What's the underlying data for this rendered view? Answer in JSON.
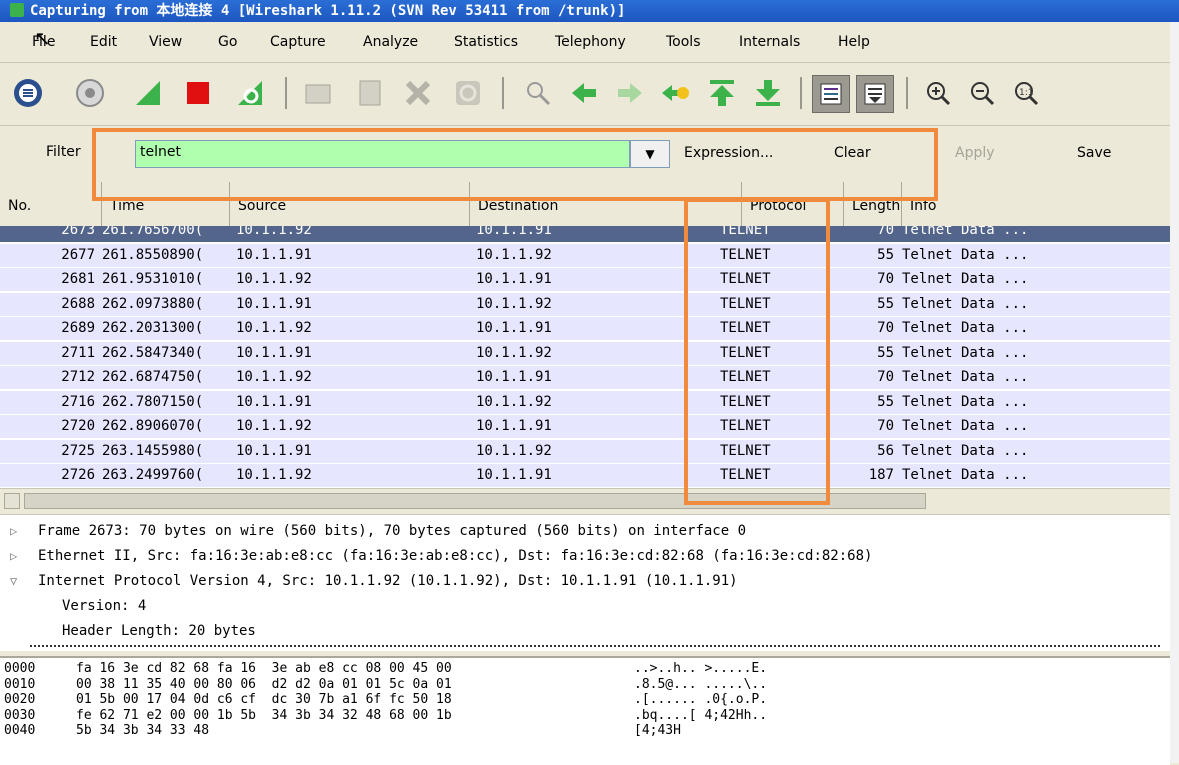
{
  "window": {
    "title": "Capturing from 本地连接 4    [Wireshark 1.11.2  (SVN Rev 53411 from /trunk)]"
  },
  "menu": [
    "File",
    "Edit",
    "View",
    "Go",
    "Capture",
    "Analyze",
    "Statistics",
    "Telephony",
    "Tools",
    "Internals",
    "Help"
  ],
  "toolbar_icons": [
    "interfaces-icon",
    "options-icon",
    "start-capture-icon",
    "stop-capture-icon",
    "restart-capture-icon",
    "open-file-icon",
    "save-file-icon",
    "close-file-icon",
    "reload-icon",
    "find-packet-icon",
    "go-back-icon",
    "go-forward-icon",
    "go-to-packet-icon",
    "go-first-icon",
    "go-last-icon",
    "colorize-icon",
    "autoscroll-icon",
    "zoom-in-icon",
    "zoom-out-icon",
    "normal-size-icon"
  ],
  "filter": {
    "label": "Filter",
    "value": "telnet",
    "expression": "Expression...",
    "clear": "Clear",
    "apply": "Apply",
    "save": "Save"
  },
  "columns": {
    "no": "No.",
    "time": "Time",
    "source": "Source",
    "destination": "Destination",
    "protocol": "Protocol",
    "length": "Length",
    "info": "Info"
  },
  "packets": [
    {
      "no": "2673",
      "time": "261.7656700(",
      "source": "10.1.1.92",
      "destination": "10.1.1.91",
      "protocol": "TELNET",
      "length": "70",
      "info": "Telnet Data ...",
      "selected": true
    },
    {
      "no": "2677",
      "time": "261.8550890(",
      "source": "10.1.1.91",
      "destination": "10.1.1.92",
      "protocol": "TELNET",
      "length": "55",
      "info": "Telnet Data ..."
    },
    {
      "no": "2681",
      "time": "261.9531010(",
      "source": "10.1.1.92",
      "destination": "10.1.1.91",
      "protocol": "TELNET",
      "length": "70",
      "info": "Telnet Data ..."
    },
    {
      "no": "2688",
      "time": "262.0973880(",
      "source": "10.1.1.91",
      "destination": "10.1.1.92",
      "protocol": "TELNET",
      "length": "55",
      "info": "Telnet Data ..."
    },
    {
      "no": "2689",
      "time": "262.2031300(",
      "source": "10.1.1.92",
      "destination": "10.1.1.91",
      "protocol": "TELNET",
      "length": "70",
      "info": "Telnet Data ..."
    },
    {
      "no": "2711",
      "time": "262.5847340(",
      "source": "10.1.1.91",
      "destination": "10.1.1.92",
      "protocol": "TELNET",
      "length": "55",
      "info": "Telnet Data ..."
    },
    {
      "no": "2712",
      "time": "262.6874750(",
      "source": "10.1.1.92",
      "destination": "10.1.1.91",
      "protocol": "TELNET",
      "length": "70",
      "info": "Telnet Data ..."
    },
    {
      "no": "2716",
      "time": "262.7807150(",
      "source": "10.1.1.91",
      "destination": "10.1.1.92",
      "protocol": "TELNET",
      "length": "55",
      "info": "Telnet Data ..."
    },
    {
      "no": "2720",
      "time": "262.8906070(",
      "source": "10.1.1.92",
      "destination": "10.1.1.91",
      "protocol": "TELNET",
      "length": "70",
      "info": "Telnet Data ..."
    },
    {
      "no": "2725",
      "time": "263.1455980(",
      "source": "10.1.1.91",
      "destination": "10.1.1.92",
      "protocol": "TELNET",
      "length": "56",
      "info": "Telnet Data ..."
    },
    {
      "no": "2726",
      "time": "263.2499760(",
      "source": "10.1.1.92",
      "destination": "10.1.1.91",
      "protocol": "TELNET",
      "length": "187",
      "info": "Telnet Data ..."
    }
  ],
  "details": [
    {
      "text": "Frame 2673: 70 bytes on wire (560 bits), 70 bytes captured (560 bits) on interface 0",
      "expanded": false,
      "indent": 0
    },
    {
      "text": "Ethernet II, Src: fa:16:3e:ab:e8:cc (fa:16:3e:ab:e8:cc), Dst: fa:16:3e:cd:82:68 (fa:16:3e:cd:82:68)",
      "expanded": false,
      "indent": 0
    },
    {
      "text": "Internet Protocol Version 4, Src: 10.1.1.92 (10.1.1.92), Dst: 10.1.1.91 (10.1.1.91)",
      "expanded": true,
      "indent": 0
    },
    {
      "text": "Version: 4",
      "indent": 1
    },
    {
      "text": "Header Length: 20 bytes",
      "indent": 1
    }
  ],
  "hex": [
    {
      "offset": "0000",
      "bytes": "fa 16 3e cd 82 68 fa 16  3e ab e8 cc 08 00 45 00",
      "ascii": "..>..h.. >.....E."
    },
    {
      "offset": "0010",
      "bytes": "00 38 11 35 40 00 80 06  d2 d2 0a 01 01 5c 0a 01",
      "ascii": ".8.5@... .....\\.."
    },
    {
      "offset": "0020",
      "bytes": "01 5b 00 17 04 0d c6 cf  dc 30 7b a1 6f fc 50 18",
      "ascii": ".[...... .0{.o.P."
    },
    {
      "offset": "0030",
      "bytes": "fe 62 71 e2 00 00 1b 5b  34 3b 34 32 48 68 00 1b",
      "ascii": ".bq....[ 4;42Hh.."
    },
    {
      "offset": "0040",
      "bytes": "5b 34 3b 34 33 48",
      "ascii": "[4;43H"
    }
  ],
  "colors": {
    "row_bg": "#e7e6ff",
    "selected_bg": "#53658a",
    "filter_ok": "#afffaf",
    "annotation": "#f08a3c"
  }
}
